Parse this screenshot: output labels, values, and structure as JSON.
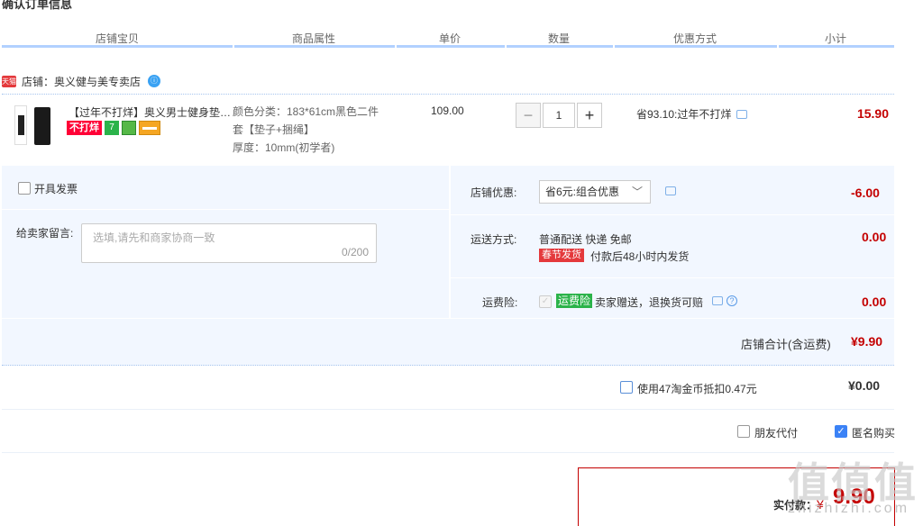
{
  "page_title": "确认订单信息",
  "table_headers": [
    "店铺宝贝",
    "商品属性",
    "单价",
    "数量",
    "优惠方式",
    "小计"
  ],
  "shop": {
    "badge": "天猫",
    "label": "店铺：奥义健与美专卖店"
  },
  "item": {
    "title": "【过年不打烊】奥义男士健身垫…",
    "tag_text": "不打烊",
    "tag_seven": "7",
    "attr_line1": "颜色分类：183*61cm黑色二件",
    "attr_line2": "套【垫子+捆绳】",
    "attr_line3": "厚度：10mm(初学者)",
    "price": "109.00",
    "qty_minus": "−",
    "qty": "1",
    "qty_plus": "+",
    "promo": "省93.10:过年不打烊",
    "subtotal": "15.90"
  },
  "invoice_label": "开具发票",
  "memo": {
    "label": "给卖家留言:",
    "placeholder": "选填,请先和商家协商一致",
    "count": "0/200"
  },
  "shop_discount": {
    "label": "店铺优惠:",
    "selected": "省6元:组合优惠",
    "chevron": "﹀",
    "amount": "-6.00"
  },
  "shipping": {
    "label": "运送方式:",
    "method": "普通配送 快递 免邮",
    "badge": "春节发货",
    "note": "付款后48小时内发货",
    "amount": "0.00"
  },
  "insurance": {
    "label": "运费险:",
    "checkmark": "✓",
    "badge": "运费险",
    "note": "卖家赠送，退换货可赔",
    "help": "?",
    "amount": "0.00"
  },
  "shop_total": {
    "label": "店铺合计(含运费)",
    "value": "¥9.90"
  },
  "coins": {
    "label": "使用47淘金币抵扣0.47元",
    "value": "¥0.00"
  },
  "friend_pay_label": "朋友代付",
  "anon_label": "匿名购买",
  "pay": {
    "label": "实付款：",
    "yen": "¥",
    "value": "9.90"
  },
  "watermark": {
    "big": "值值值",
    "small": "zhizhizhi.com"
  },
  "colors": {
    "accent_red": "#c40000",
    "header_bar": "#b2d1ff",
    "panel_bg": "#f2f7ff"
  }
}
